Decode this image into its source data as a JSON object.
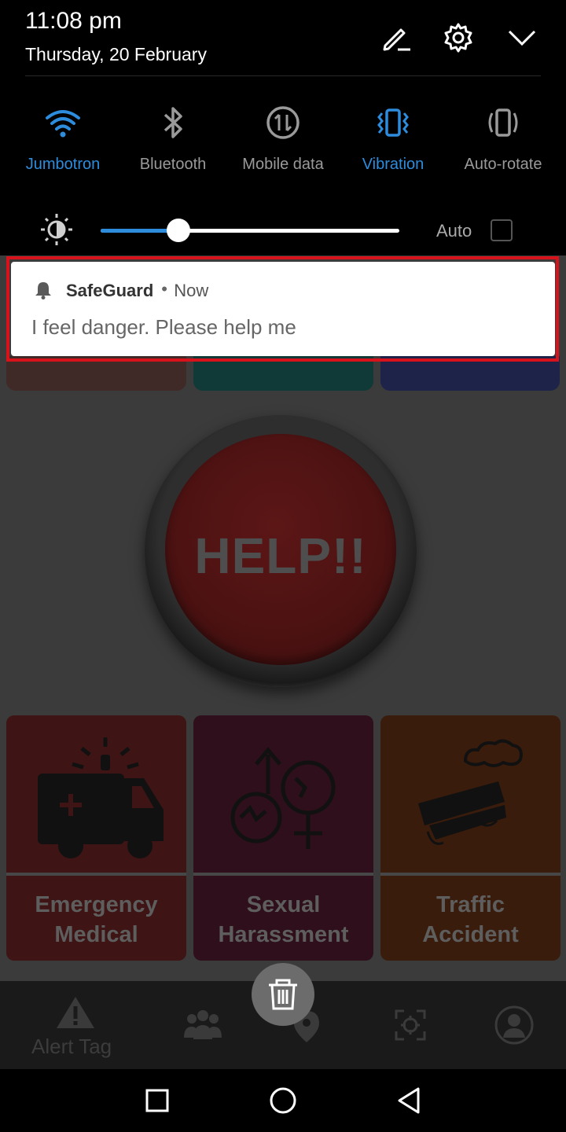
{
  "status": {
    "time": "11:08 pm",
    "date": "Thursday, 20 February"
  },
  "header_icons": [
    "edit-icon",
    "settings-icon",
    "collapse-chevron-icon"
  ],
  "quick_tiles": [
    {
      "label": "Jumbotron",
      "icon": "wifi-icon",
      "active": true
    },
    {
      "label": "Bluetooth",
      "icon": "bluetooth-icon",
      "active": false
    },
    {
      "label": "Mobile data",
      "icon": "mobile-data-icon",
      "active": false
    },
    {
      "label": "Vibration",
      "icon": "vibration-icon",
      "active": true
    },
    {
      "label": "Auto-rotate",
      "icon": "auto-rotate-icon",
      "active": false
    }
  ],
  "brightness": {
    "level": 0.26,
    "auto_label": "Auto",
    "auto_checked": false
  },
  "notification": {
    "app": "SafeGuard",
    "separator": "•",
    "time": "Now",
    "message": "I feel danger. Please help me"
  },
  "app": {
    "help_button": "HELP!!",
    "cards": [
      {
        "label": "Emergency\nMedical",
        "icon": "ambulance-icon"
      },
      {
        "label": "Sexual\nHarassment",
        "icon": "gender-symbols-icon"
      },
      {
        "label": "Traffic\nAccident",
        "icon": "crashed-car-icon"
      }
    ],
    "nav": {
      "alert_tag": "Alert Tag",
      "items": [
        "alert-icon",
        "group-icon",
        "location-pin-icon",
        "target-icon",
        "profile-icon"
      ]
    },
    "trash_icon": "trash-icon"
  },
  "colors": {
    "accent": "#2d8cdc",
    "highlight": "#d8121b",
    "help_red": "#4d1212"
  },
  "system_nav": [
    "back-icon",
    "home-icon",
    "recents-icon"
  ]
}
